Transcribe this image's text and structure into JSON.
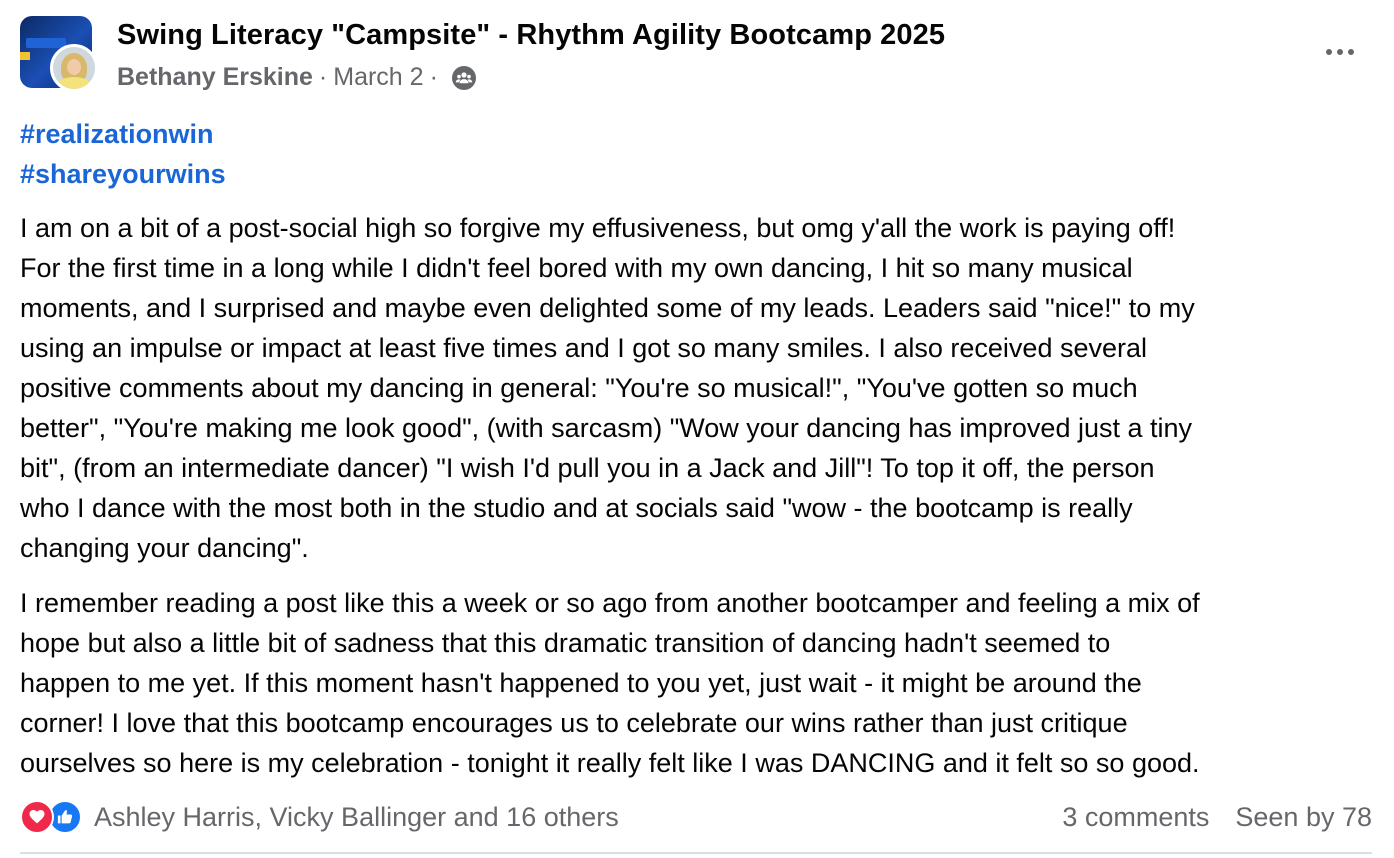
{
  "post": {
    "group_name": "Swing Literacy \"Campsite\" - Rhythm Agility Bootcamp 2025",
    "author": "Bethany Erskine",
    "separator": "·",
    "date": "March 2",
    "privacy_icon": "group-members-icon",
    "more_icon": "more-options-icon",
    "hashtags": [
      "#realizationwin",
      "#shareyourwins"
    ],
    "paragraphs": [
      "I am on a bit of a post-social high so forgive my effusiveness, but omg y'all the work is paying off!\nFor the first time in a long while I didn't feel bored with my own dancing, I hit so many musical\nmoments, and I surprised and maybe even delighted some of my leads. Leaders said \"nice!\" to my\nusing an impulse or impact at least five times and I got so many smiles. I also received several\npositive comments about my dancing in general: \"You're so musical!\", \"You've gotten so much\nbetter\", \"You're making me look good\", (with sarcasm) \"Wow your dancing has improved just a tiny\nbit\", (from an intermediate dancer) \"I wish I'd pull you in a Jack and Jill\"! To top it off, the person\nwho I dance with the most both in the studio and at socials said \"wow - the bootcamp is really\nchanging your dancing\".",
      "I remember reading a post like this a week or so ago from another bootcamper and feeling a mix of\nhope but also a little bit of sadness that this dramatic transition of dancing hadn't seemed to\nhappen to me yet. If this moment hasn't happened to you yet, just wait - it might be around the\ncorner! I love that this bootcamp encourages us to celebrate our wins rather than just critique\nourselves so here is my celebration - tonight it really felt like I was DANCING and it felt so so good."
    ]
  },
  "footer": {
    "reaction_icons": [
      "love-reaction-icon",
      "like-reaction-icon"
    ],
    "reactors": "Ashley Harris, Vicky Ballinger and 16 others",
    "comments": "3 comments",
    "seen_by": "Seen by 78"
  },
  "colors": {
    "hashtag": "#1a66d6",
    "secondary_text": "#65676b",
    "love": "#f02849",
    "like": "#1877f2"
  }
}
